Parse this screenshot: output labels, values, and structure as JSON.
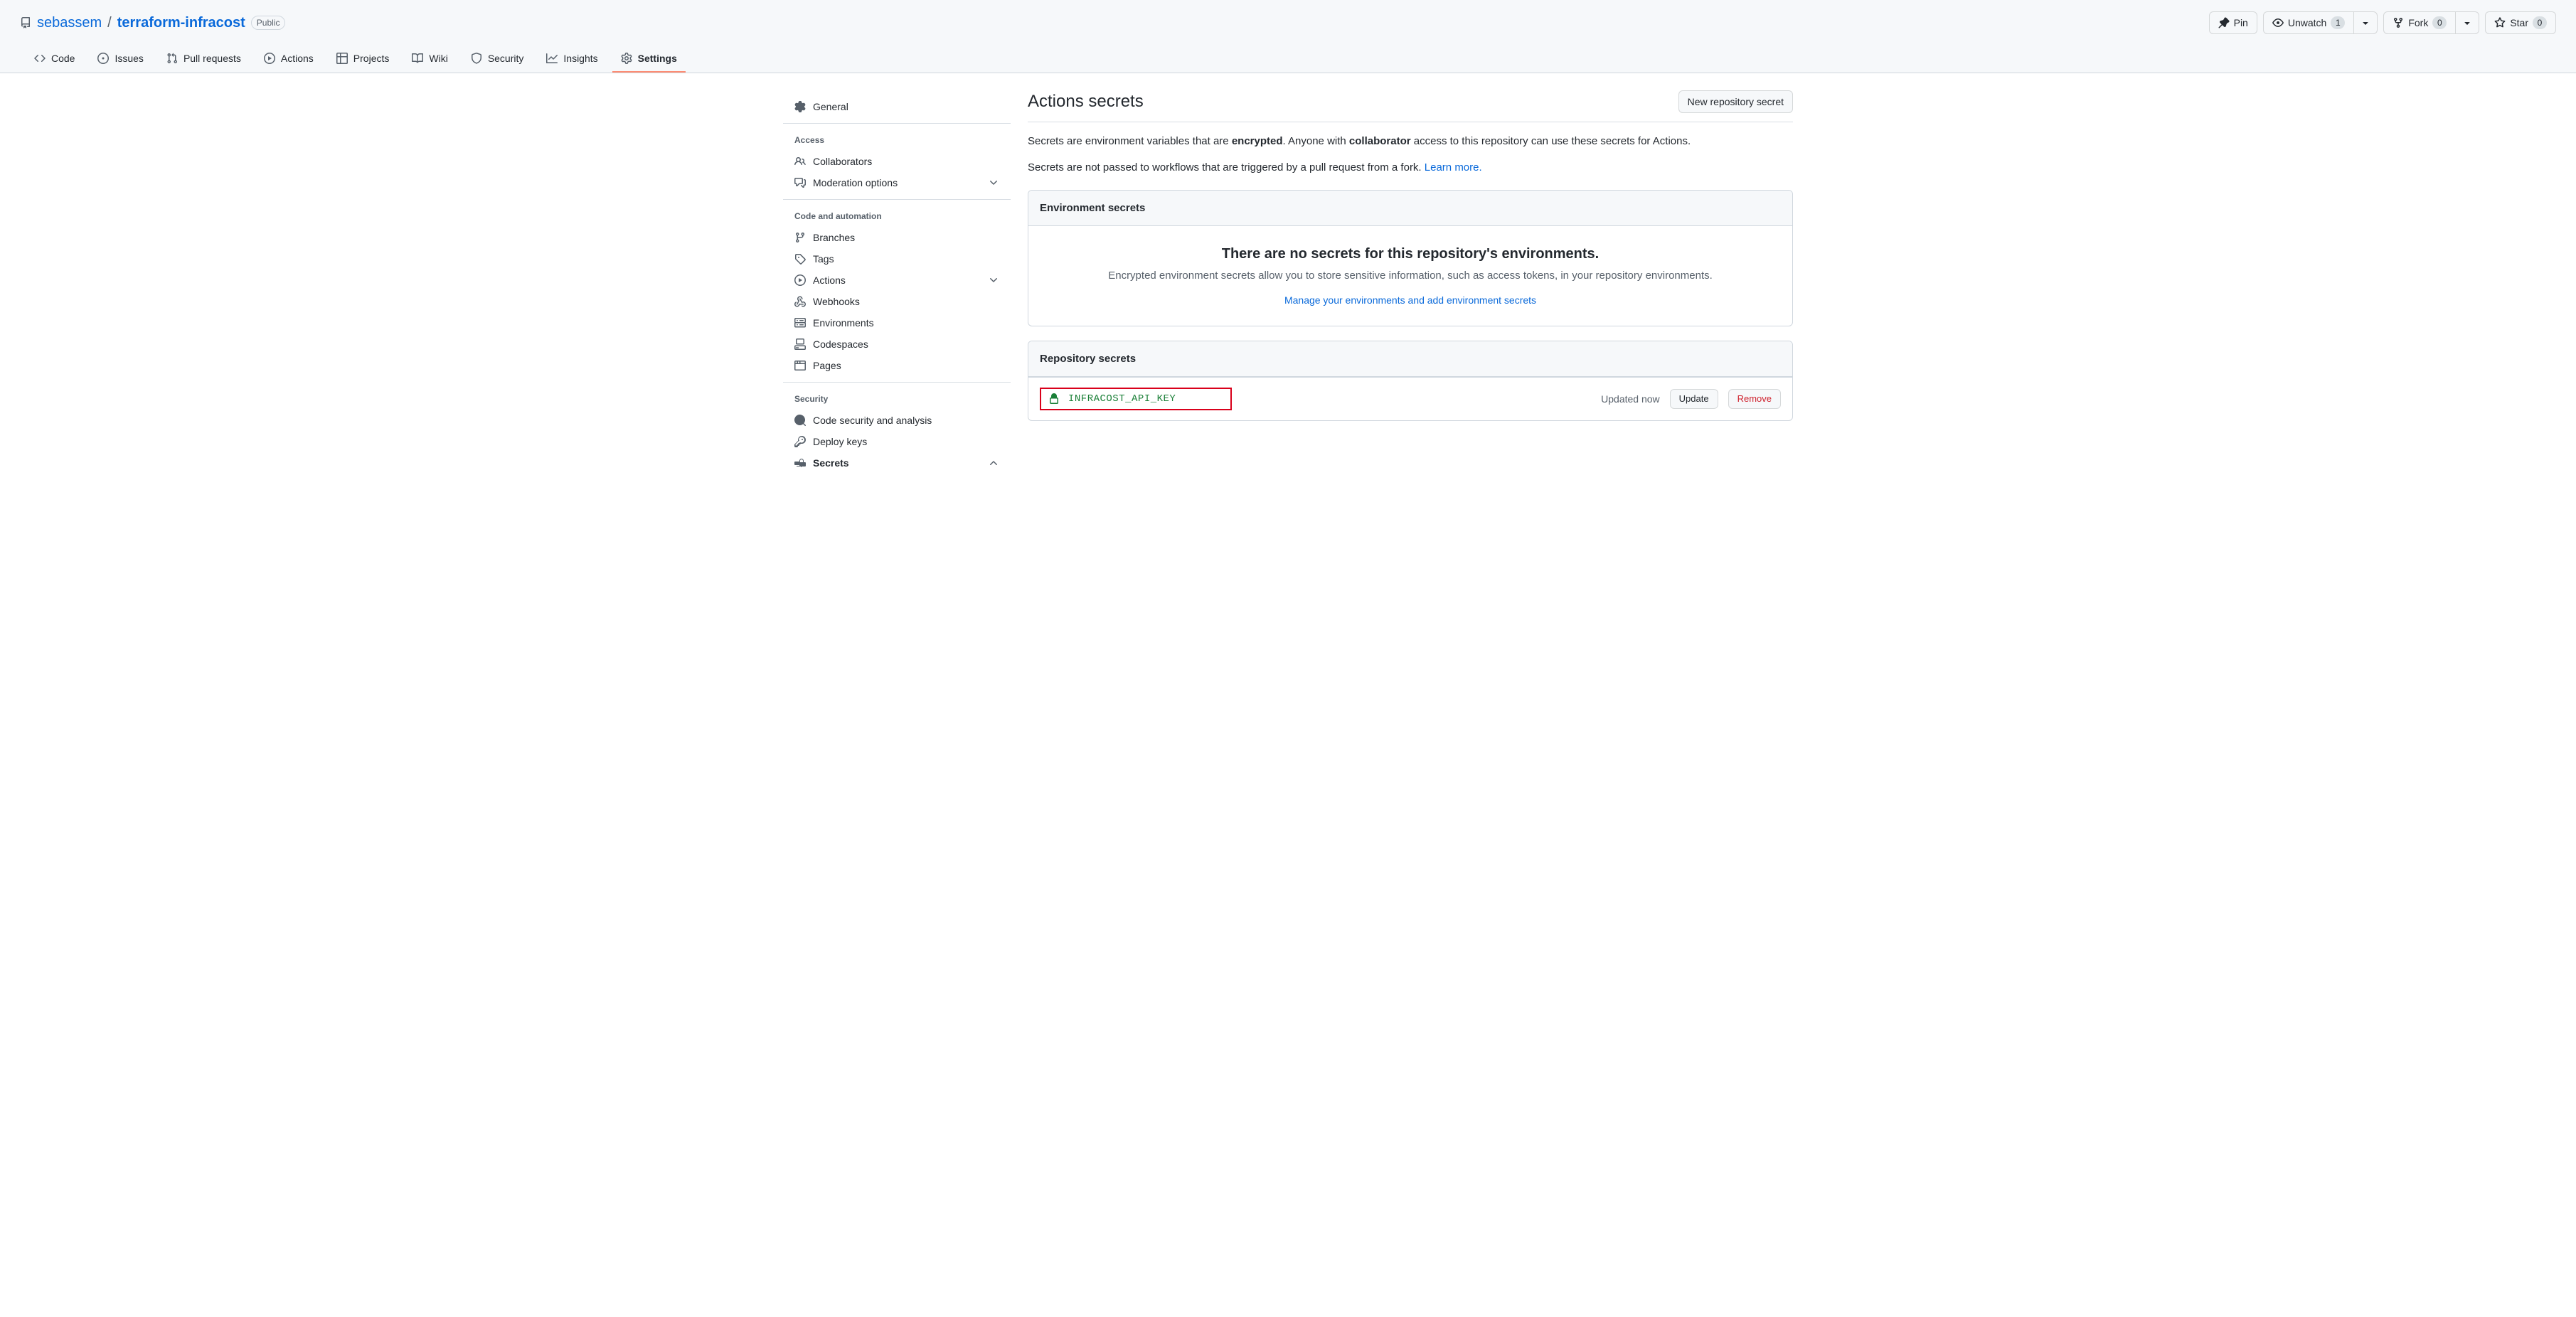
{
  "repo": {
    "owner": "sebassem",
    "name": "terraform-infracost",
    "visibility": "Public"
  },
  "header_actions": {
    "pin": "Pin",
    "watch": "Unwatch",
    "watch_count": "1",
    "fork": "Fork",
    "fork_count": "0",
    "star": "Star",
    "star_count": "0"
  },
  "tabs": {
    "code": "Code",
    "issues": "Issues",
    "pulls": "Pull requests",
    "actions": "Actions",
    "projects": "Projects",
    "wiki": "Wiki",
    "security": "Security",
    "insights": "Insights",
    "settings": "Settings"
  },
  "sidebar": {
    "general": "General",
    "access_heading": "Access",
    "collaborators": "Collaborators",
    "moderation": "Moderation options",
    "code_heading": "Code and automation",
    "branches": "Branches",
    "tags": "Tags",
    "actions": "Actions",
    "webhooks": "Webhooks",
    "environments": "Environments",
    "codespaces": "Codespaces",
    "pages": "Pages",
    "security_heading": "Security",
    "code_security": "Code security and analysis",
    "deploy_keys": "Deploy keys",
    "secrets": "Secrets"
  },
  "main": {
    "title": "Actions secrets",
    "new_secret_btn": "New repository secret",
    "desc1_a": "Secrets are environment variables that are ",
    "desc1_b": "encrypted",
    "desc1_c": ". Anyone with ",
    "desc1_d": "collaborator",
    "desc1_e": " access to this repository can use these secrets for Actions.",
    "desc2_a": "Secrets are not passed to workflows that are triggered by a pull request from a fork. ",
    "desc2_link": "Learn more.",
    "env_panel_title": "Environment secrets",
    "env_empty_title": "There are no secrets for this repository's environments.",
    "env_empty_desc": "Encrypted environment secrets allow you to store sensitive information, such as access tokens, in your repository environments.",
    "env_manage_link": "Manage your environments and add environment secrets",
    "repo_panel_title": "Repository secrets",
    "secret_name": "INFRACOST_API_KEY",
    "secret_updated": "Updated now",
    "update_btn": "Update",
    "remove_btn": "Remove"
  }
}
